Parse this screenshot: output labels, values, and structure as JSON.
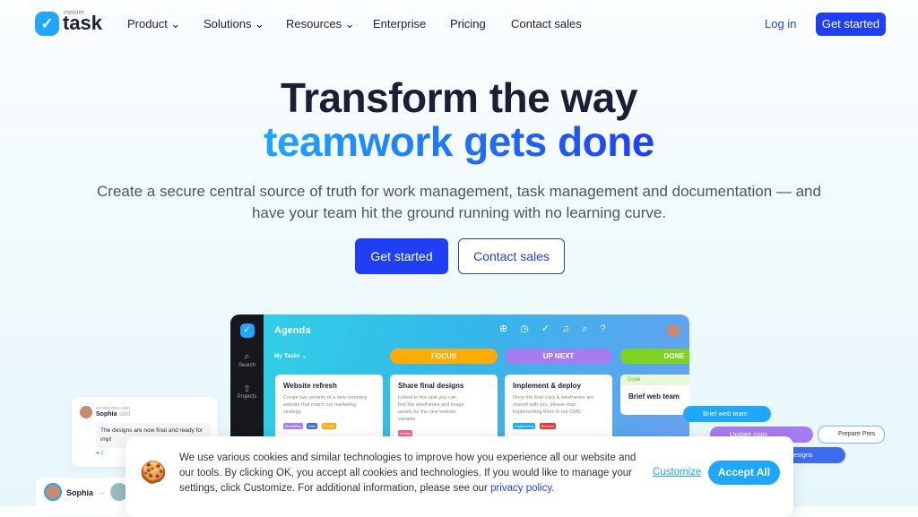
{
  "brand": {
    "small": "meister",
    "name": "task"
  },
  "nav": {
    "items": [
      "Product",
      "Solutions",
      "Resources",
      "Enterprise",
      "Pricing",
      "Contact sales"
    ],
    "login": "Log in",
    "get_started": "Get started"
  },
  "hero": {
    "line1": "Transform the way",
    "line2": "teamwork gets done",
    "subtitle": "Create a secure central source of truth for work management, task management and documentation — and have your team hit the ground running with no learning curve.",
    "cta_primary": "Get started",
    "cta_secondary": "Contact sales"
  },
  "app": {
    "title": "Agenda",
    "side": [
      "Search",
      "Projects"
    ],
    "filter": "My Tasks",
    "columns": [
      "FOCUS",
      "UP NEXT",
      "DONE"
    ],
    "cards": [
      {
        "title": "Website refresh",
        "desc": "Create two variants of a new company website that match our marketing strategy.",
        "tags": [
          "Marketing",
          "Web",
          "Priority"
        ]
      },
      {
        "title": "Share final designs",
        "desc": "Linked to this task you can find the wireframes and image assets for the new website variants.",
        "tags": [
          "Design"
        ]
      },
      {
        "title": "Implement & deploy",
        "desc": "Once the final copy & wireframes are shared with you, please start implementing them in our CMS.",
        "tags": [
          "Engineering",
          "Blocked"
        ]
      },
      {
        "status": "Done",
        "title": "Brief web team"
      }
    ]
  },
  "comment": {
    "time": "20 MINUTES AGO",
    "author": "Sophia",
    "said": "said",
    "text": "The designs are now final and ready for impl",
    "likes": "2"
  },
  "handoff": {
    "name": "Sophia",
    "arrow": "→"
  },
  "pills": [
    "Brief web team",
    "Update copy",
    "Prepare Pres",
    "esigns"
  ],
  "cookie": {
    "text": "We use various cookies and similar technologies to improve how you experience all our website and our tools. By clicking OK, you accept all cookies and technologies. If you would like to manage your settings, click Customize. For additional information, please see our ",
    "link": "privacy policy",
    "end": ".",
    "customize": "Customize",
    "accept": "Accept All"
  },
  "colors": {
    "primary": "#1f3ff5",
    "focus": "#ffab00",
    "upnext": "#a77cf0",
    "done": "#7ed321"
  }
}
